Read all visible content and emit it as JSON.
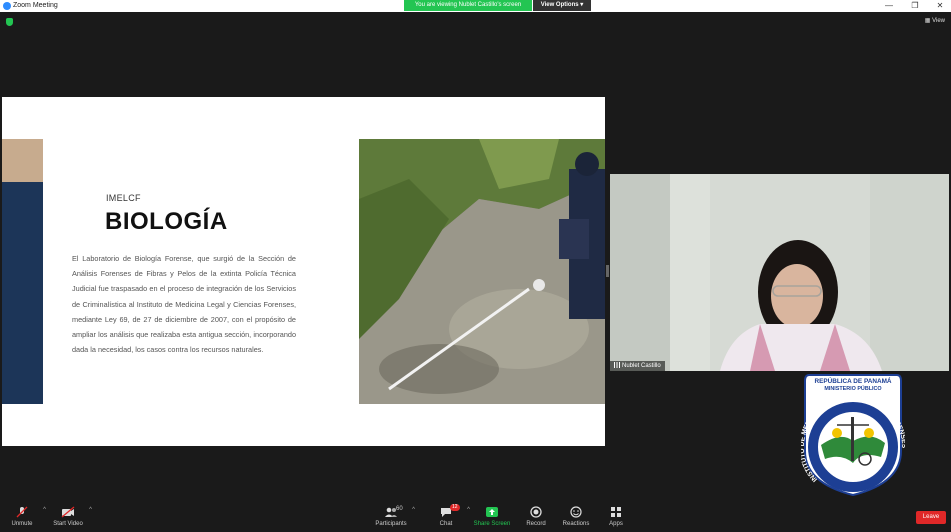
{
  "window": {
    "title": "Zoom Meeting"
  },
  "share": {
    "banner": "You are viewing Nublet Castillo's screen",
    "view_options": "View Options"
  },
  "top_right": {
    "view_label": "View"
  },
  "slide": {
    "label": "IMELCF",
    "heading": "BIOLOGÍA",
    "body": "El Laboratorio de Biología Forense, que surgió de la Sección de Análisis Forenses de Fibras y Pelos de la extinta Policía Técnica Judicial fue traspasado en el proceso de integración de los Servicios de Criminalística al Instituto de Medicina Legal y Ciencias Forenses, mediante Ley 69,  de 27 de diciembre de 2007, con el propósito de ampliar los análisis que realizaba esta antigua sección, incorporando dada la necesidad, los casos contra los recursos naturales."
  },
  "participant": {
    "name": "Nublet Castillo"
  },
  "emblem": {
    "top_line1": "REPÚBLICA DE PANAMÁ",
    "top_line2": "MINISTERIO PÚBLICO",
    "ring_left": "INSTITUTO DE MEDICINA LEGAL Y",
    "ring_right": "CIENCIAS FORENSES"
  },
  "toolbar": {
    "unmute": "Unmute",
    "start_video": "Start Video",
    "participants": "Participants",
    "participants_count": "60",
    "chat": "Chat",
    "chat_badge": "12",
    "share_screen": "Share Screen",
    "record": "Record",
    "reactions": "Reactions",
    "apps": "Apps",
    "leave": "Leave"
  },
  "colors": {
    "share_green": "#23c552",
    "leave_red": "#e02828",
    "slide_navy": "#1c3558",
    "slide_tan": "#c7ab8e"
  }
}
